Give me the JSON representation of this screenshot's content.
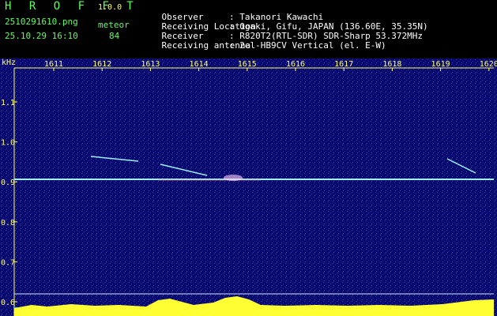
{
  "header": {
    "app_title": "H R O F F T",
    "version": "1.0.0",
    "filename": "2510291610.png",
    "datetime": "25.10.29 16:10",
    "meteor_label": "meteor",
    "meteor_count": "84",
    "info": [
      {
        "label": "Observer",
        "value": ": Takanori Kawachi"
      },
      {
        "label": "Receiving Location",
        "value": ": Ogaki, Gifu, JAPAN (136.60E, 35.35N)"
      },
      {
        "label": "Receiver",
        "value": ": R820T2(RTL-SDR) SDR-Sharp 53.372MHz"
      },
      {
        "label": "Receiving antenna",
        "value": ": 2el-HB9CV Vertical (el. E-W)"
      }
    ]
  },
  "spectrogram": {
    "y_unit": "kHz",
    "y_ticks": [
      "1.1",
      "1.0",
      "0.9",
      "0.8",
      "0.7",
      "0.6"
    ],
    "x_ticks": [
      "1611",
      "1612",
      "1613",
      "1614",
      "1615",
      "1616",
      "1617",
      "1618",
      "1619",
      "1620"
    ],
    "colors": {
      "background": "#0a0a6e",
      "axis": "#ffff66",
      "carrier": "#9cf0ff",
      "meteor": "#9cf0ff",
      "level": "#ffff33",
      "level_base": "#00d0ff"
    }
  }
}
